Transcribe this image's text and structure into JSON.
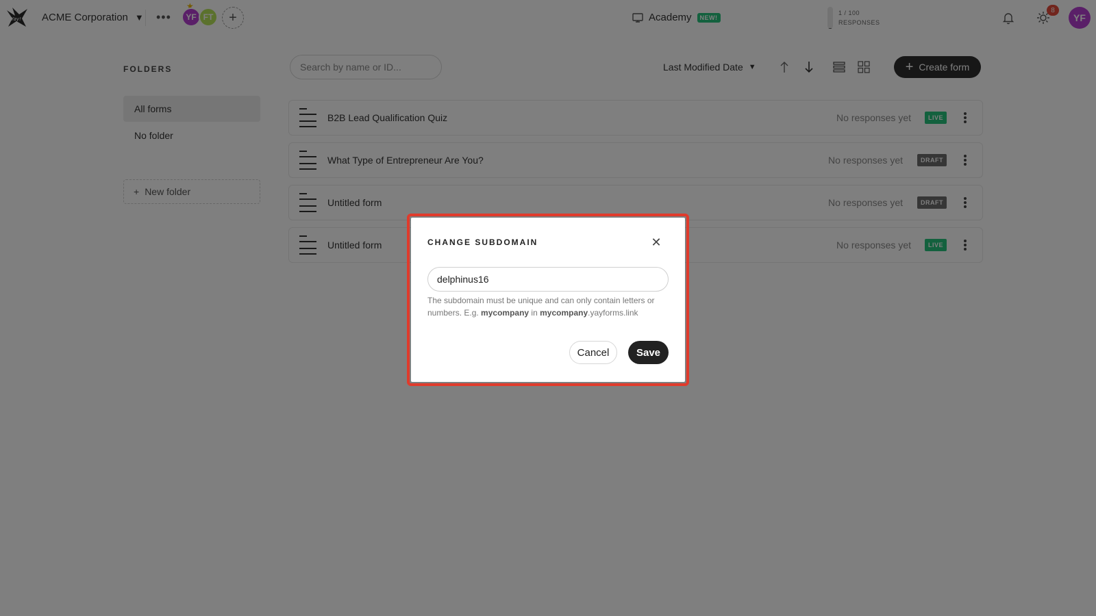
{
  "topbar": {
    "workspace_name": "ACME Corporation",
    "members": [
      {
        "initials": "YF",
        "color": "#b53fd0"
      },
      {
        "initials": "FT",
        "color": "#b6e25a"
      }
    ],
    "academy_label": "Academy",
    "academy_badge": "NEW!",
    "usage_text": "1 / 100",
    "usage_label": "RESPONSES",
    "usage_fraction": 0.01,
    "notification_count": "8",
    "user_initials": "YF"
  },
  "sidebar": {
    "title": "FOLDERS",
    "items": [
      {
        "label": "All forms",
        "active": true
      },
      {
        "label": "No folder",
        "active": false
      }
    ],
    "new_folder_label": "New folder"
  },
  "toolbar": {
    "search_placeholder": "Search by name or ID...",
    "sort_label": "Last Modified Date",
    "create_label": "Create form"
  },
  "forms": [
    {
      "name": "B2B Lead Qualification Quiz",
      "responses": "No responses yet",
      "status": "LIVE"
    },
    {
      "name": "What Type of Entrepreneur Are You?",
      "responses": "No responses yet",
      "status": "DRAFT"
    },
    {
      "name": "Untitled form",
      "responses": "No responses yet",
      "status": "DRAFT"
    },
    {
      "name": "Untitled form",
      "responses": "No responses yet",
      "status": "LIVE"
    }
  ],
  "modal": {
    "title": "CHANGE SUBDOMAIN",
    "input_value": "delphinus16",
    "help_prefix": "The subdomain must be unique and can only contain letters or numbers. E.g.",
    "help_example": "mycompany",
    "help_in": "in",
    "help_domain_bold": "mycompany",
    "help_domain_rest": ".yayforms.link",
    "cancel_label": "Cancel",
    "save_label": "Save"
  },
  "colors": {
    "live": "#27c27d",
    "draft": "#6c6c6c",
    "accent_dark": "#2e2e2e",
    "highlight": "#e03b2c"
  }
}
